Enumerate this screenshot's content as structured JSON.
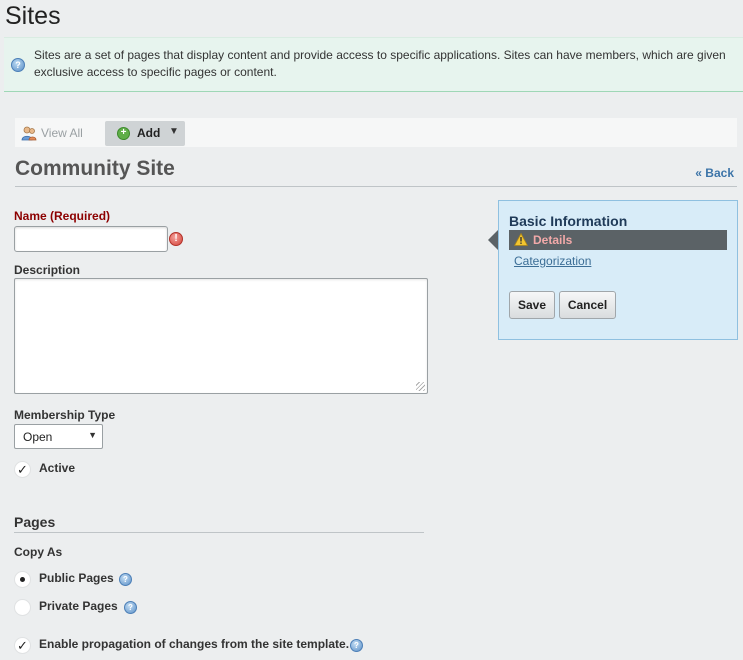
{
  "page": {
    "title": "Sites"
  },
  "info": {
    "text": "Sites are a set of pages that display content and provide access to specific applications. Sites can have members, which are given exclusive access to specific pages or content.",
    "icon": "info-icon"
  },
  "toolbar": {
    "view_all_label": "View All",
    "add_label": "Add"
  },
  "form": {
    "title": "Community Site",
    "back_label": "« Back",
    "name_label": "Name (Required)",
    "name_value": "",
    "description_label": "Description",
    "description_value": "",
    "membership_label": "Membership Type",
    "membership_value": "Open",
    "active_label": "Active",
    "active_checked": true
  },
  "pages": {
    "heading": "Pages",
    "copy_as_label": "Copy As",
    "public_label": "Public Pages",
    "private_label": "Private Pages",
    "selected": "Public Pages",
    "propagation_label": "Enable propagation of changes from the site template.",
    "propagation_checked": true
  },
  "side": {
    "title": "Basic Information",
    "active_item": "Details",
    "link_item": "Categorization",
    "save_label": "Save",
    "cancel_label": "Cancel"
  },
  "colors": {
    "required": "#8c0000",
    "info_bg": "#e7f4ee",
    "panel_bg": "#d8ecf8",
    "active_item_bg": "#5b6266",
    "link": "#3c6e96"
  }
}
